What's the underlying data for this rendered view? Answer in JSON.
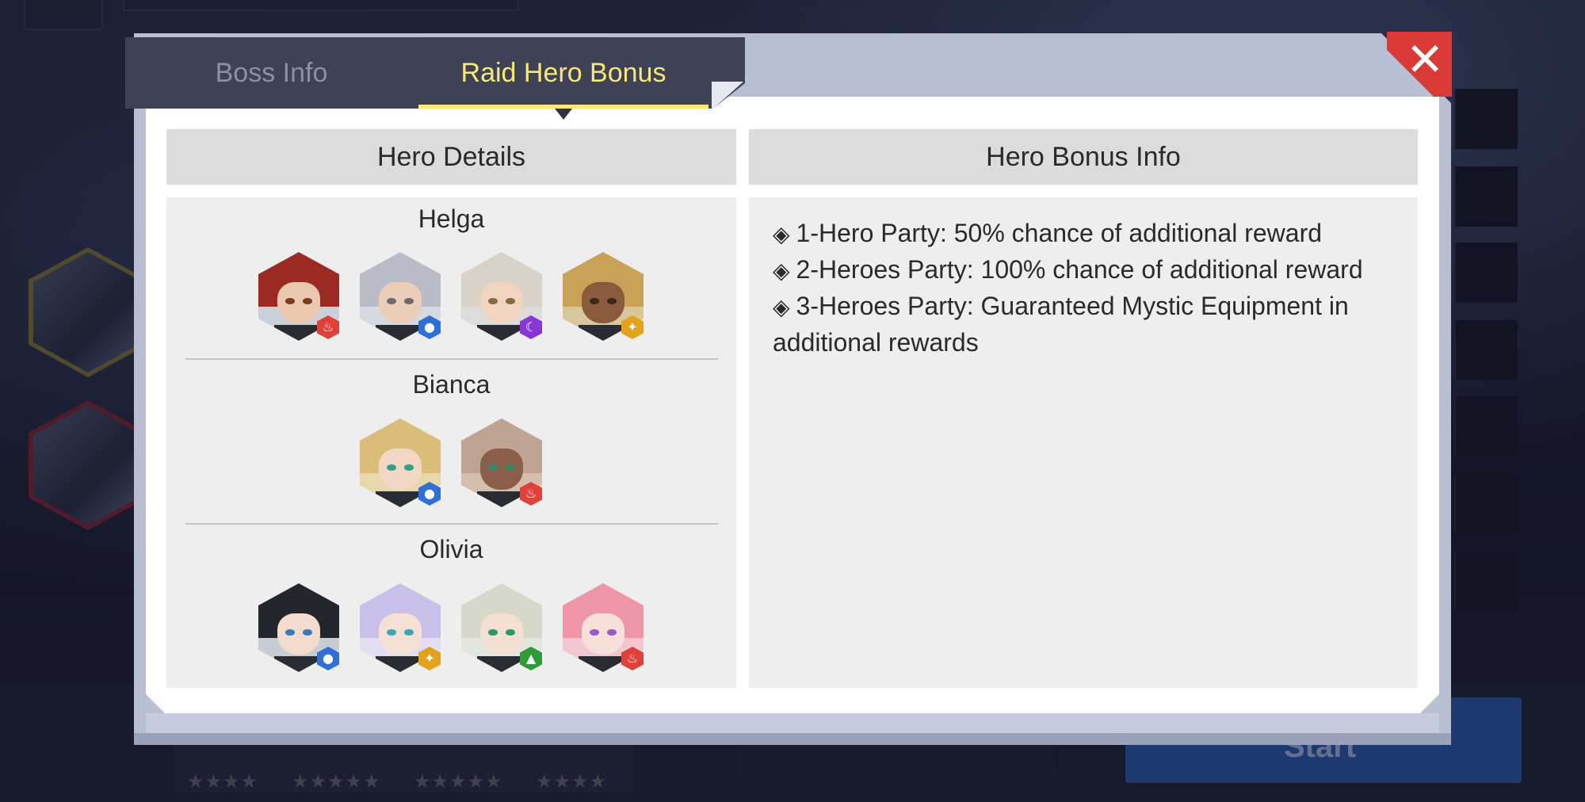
{
  "background": {
    "start_button_label": "Start",
    "bottom_card_stars": [
      "★★★★",
      "★★★★★",
      "★★★★★",
      "★★★★"
    ]
  },
  "tabs": [
    {
      "label": "Boss Info",
      "active": false
    },
    {
      "label": "Raid Hero Bonus",
      "active": true
    }
  ],
  "close_icon": "close-icon",
  "colors": {
    "active_tab": "#f5e874",
    "inactive_tab": "#8d90a2",
    "close_button": "#d93a36",
    "element_fire": "#e0403a",
    "element_water": "#2f6fd6",
    "element_dark": "#8a35d6",
    "element_light": "#e3a21c",
    "element_earth": "#2e9a3a"
  },
  "left_panel": {
    "header": "Hero Details",
    "groups": [
      {
        "name": "Helga",
        "heroes": [
          {
            "element": "fire",
            "icon": "fire-element-icon",
            "glyph": "♨"
          },
          {
            "element": "water",
            "icon": "water-element-icon",
            "glyph": "●"
          },
          {
            "element": "dark",
            "icon": "moon-element-icon",
            "glyph": "☾"
          },
          {
            "element": "light",
            "icon": "star-element-icon",
            "glyph": "✦"
          }
        ]
      },
      {
        "name": "Bianca",
        "heroes": [
          {
            "element": "water",
            "icon": "water-element-icon",
            "glyph": "●"
          },
          {
            "element": "fire",
            "icon": "fire-element-icon",
            "glyph": "♨"
          }
        ]
      },
      {
        "name": "Olivia",
        "heroes": [
          {
            "element": "water",
            "icon": "water-element-icon",
            "glyph": "●"
          },
          {
            "element": "light",
            "icon": "star-element-icon",
            "glyph": "✦"
          },
          {
            "element": "earth",
            "icon": "mountain-element-icon",
            "glyph": "▲"
          },
          {
            "element": "fire",
            "icon": "fire-element-icon",
            "glyph": "♨"
          }
        ]
      }
    ]
  },
  "right_panel": {
    "header": "Hero Bonus Info",
    "bullet": "◈",
    "lines": [
      "1-Hero Party: 50% chance of additional reward",
      "2-Heroes Party: 100% chance of additional reward",
      "3-Heroes Party: Guaranteed Mystic Equipment in",
      "additional rewards"
    ]
  }
}
